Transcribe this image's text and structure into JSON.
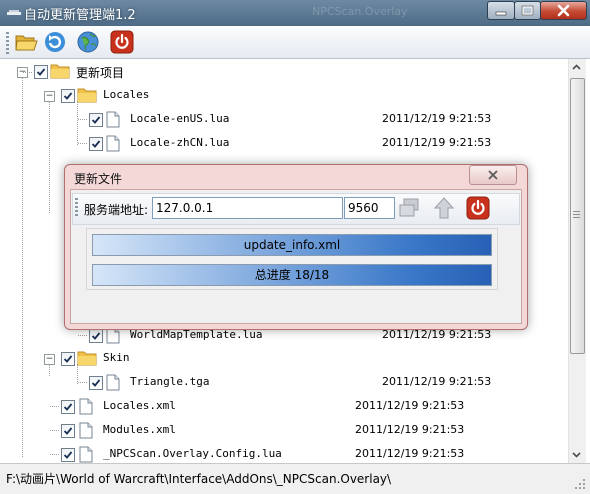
{
  "window": {
    "title": "自动更新管理端1.2",
    "ghost_title": "NPCScan.Overlay"
  },
  "toolbar": {
    "buttons": [
      {
        "name": "open",
        "icon": "folder-open-icon"
      },
      {
        "name": "refresh",
        "icon": "refresh-icon"
      },
      {
        "name": "network",
        "icon": "globe-icon"
      },
      {
        "name": "power",
        "icon": "power-icon"
      }
    ]
  },
  "tree": {
    "root": {
      "label": "更新项目",
      "checked": true,
      "expanded": true
    },
    "locales_folder": {
      "label": "Locales",
      "checked": true,
      "expanded": true
    },
    "locales_files": [
      {
        "label": "Locale-enUS.lua",
        "date": "2011/12/19 9:21:53",
        "checked": true
      },
      {
        "label": "Locale-zhCN.lua",
        "date": "2011/12/19 9:21:53",
        "checked": true
      }
    ],
    "worldmap_file": {
      "label": "WorldMapTemplate.lua",
      "date": "2011/12/19 9:21:53",
      "checked": true
    },
    "skin_folder": {
      "label": "Skin",
      "checked": true,
      "expanded": true
    },
    "skin_files": [
      {
        "label": "Triangle.tga",
        "date": "2011/12/19 9:21:53",
        "checked": true
      }
    ],
    "root_files": [
      {
        "label": "Locales.xml",
        "date": "2011/12/19 9:21:53",
        "checked": true
      },
      {
        "label": "Modules.xml",
        "date": "2011/12/19 9:21:53",
        "checked": true
      },
      {
        "label": "_NPCScan.Overlay.Config.lua",
        "date": "2011/12/19 9:21:53",
        "checked": true
      }
    ]
  },
  "status": {
    "path": "F:\\动画片\\World of Warcraft\\Interface\\AddOns\\_NPCScan.Overlay\\"
  },
  "dialog": {
    "title": "更新文件",
    "server_label": "服务端地址:",
    "server_address": "127.0.0.1",
    "server_port": "9560",
    "file_progress": {
      "text": "update_info.xml",
      "fraction": 1.0
    },
    "total_progress": {
      "text": "总进度 18/18",
      "fraction": 1.0
    }
  },
  "colors": {
    "title_bar": "#5a7792",
    "progress_fill": "#2f6cc0",
    "dialog_frame": "#f4d8d8",
    "close_red": "#c03a22"
  }
}
